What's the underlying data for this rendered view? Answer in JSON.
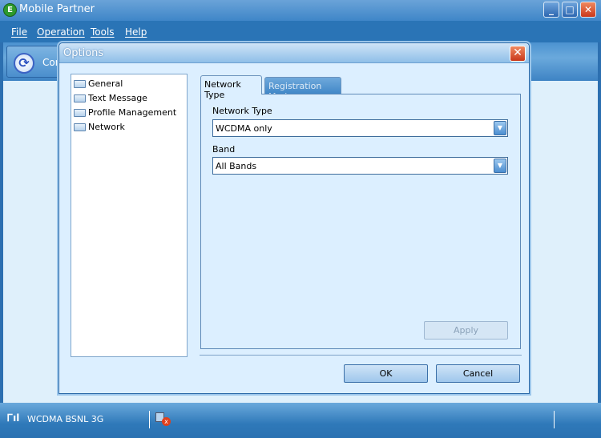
{
  "app": {
    "title": "Mobile Partner",
    "icon": "mobile-partner-logo"
  },
  "window_controls": {
    "minimize": "_",
    "maximize": "□",
    "close": "✕"
  },
  "menu": [
    "File",
    "Operation",
    "Tools",
    "Help"
  ],
  "toolbar": {
    "connect_label": "Con"
  },
  "dialog": {
    "title": "Options",
    "close": "✕",
    "tree": [
      "General",
      "Text Message",
      "Profile Management",
      "Network"
    ],
    "tabs": [
      "Network Type",
      "Registration Mode"
    ],
    "active_tab": "Network Type",
    "network_type_label": "Network Type",
    "network_type_value": "WCDMA only",
    "band_label": "Band",
    "band_value": "All Bands",
    "apply": "Apply",
    "ok": "OK",
    "cancel": "Cancel"
  },
  "status": {
    "network": "WCDMA  BSNL 3G",
    "signal_icon": "signal-bars",
    "connection_icon": "disconnected"
  }
}
